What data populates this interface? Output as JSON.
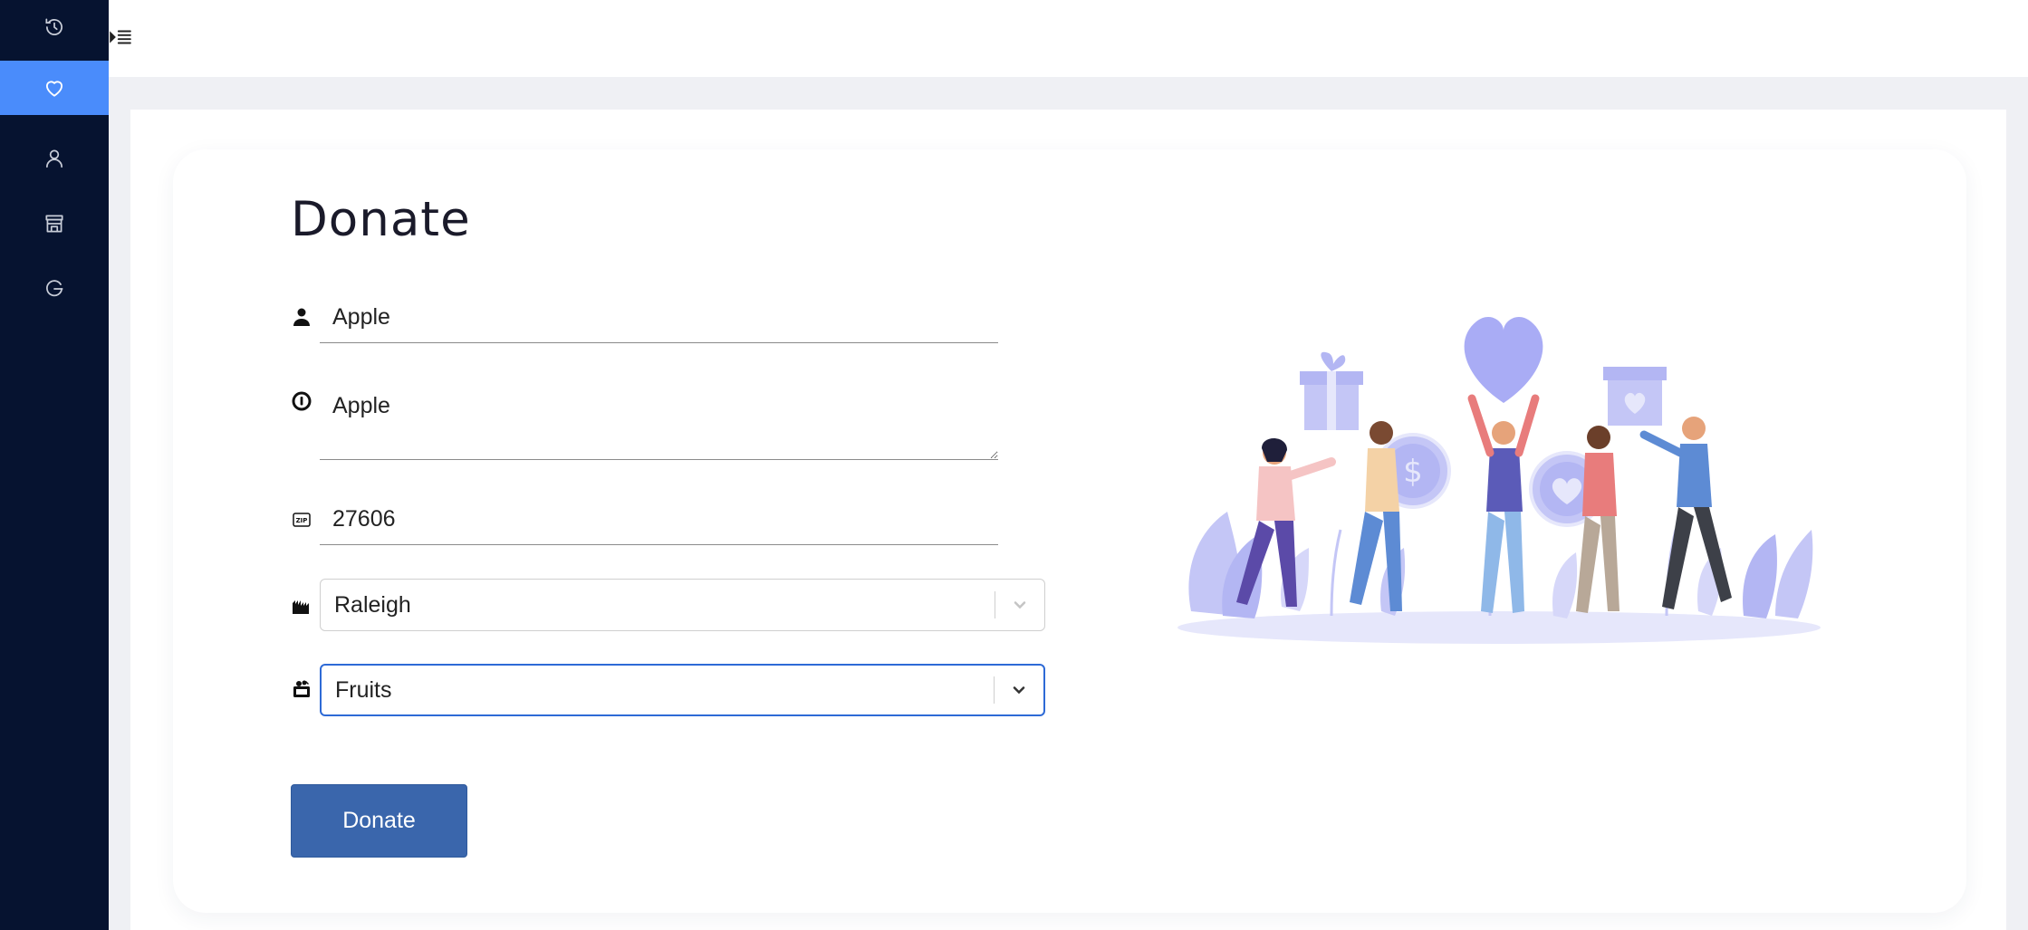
{
  "sidebar": {
    "items": [
      {
        "icon": "history-icon",
        "active": false
      },
      {
        "icon": "heart-icon",
        "active": true
      },
      {
        "icon": "user-icon",
        "active": false
      },
      {
        "icon": "store-icon",
        "active": false
      },
      {
        "icon": "logout-icon",
        "active": false
      }
    ]
  },
  "topbar": {
    "toggle_icon": "menu-toggle-icon"
  },
  "form": {
    "title": "Donate",
    "name_value": "Apple",
    "description_value": "Apple",
    "zip_value": "27606",
    "city_value": "Raleigh",
    "category_value": "Fruits",
    "submit_label": "Donate"
  },
  "colors": {
    "sidebar_bg": "#061330",
    "sidebar_active": "#4a8cfb",
    "button": "#3a66ac",
    "focus_border": "#2e6ad6",
    "illustration_accent": "#a9acf5"
  }
}
